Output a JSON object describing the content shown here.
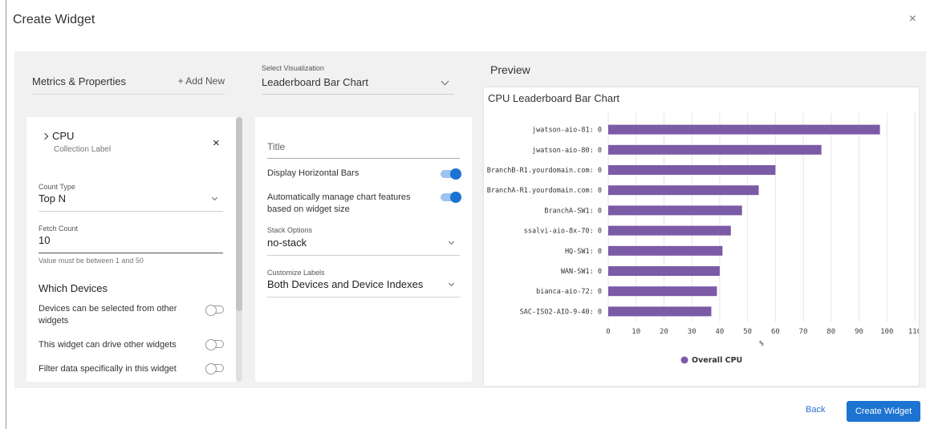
{
  "dialog": {
    "title": "Create Widget",
    "close": "×"
  },
  "metrics": {
    "title": "Metrics & Properties",
    "add_new": "+ Add New",
    "item": {
      "name": "CPU",
      "collection_label": "Collection Label",
      "remove": "×"
    },
    "count_type": {
      "label": "Count Type",
      "value": "Top N"
    },
    "fetch_count": {
      "label": "Fetch Count",
      "value": "10",
      "hint": "Value must be between 1 and 50"
    },
    "which_devices": {
      "title": "Which Devices",
      "toggles": [
        {
          "label": "Devices can be selected from other widgets",
          "on": false
        },
        {
          "label": "This widget can drive other widgets",
          "on": false
        },
        {
          "label": "Filter data specifically in this widget",
          "on": false
        }
      ]
    }
  },
  "visualization": {
    "label": "Select Visualization",
    "value": "Leaderboard Bar Chart",
    "title_placeholder": "Title",
    "horizontal_bars": {
      "label": "Display Horizontal Bars",
      "on": true
    },
    "auto_manage": {
      "label": "Automatically manage chart features based on widget size",
      "on": true
    },
    "stack_options": {
      "label": "Stack Options",
      "value": "no-stack"
    },
    "customize_labels": {
      "label": "Customize Labels",
      "value": "Both Devices and Device Indexes"
    }
  },
  "preview": {
    "label": "Preview"
  },
  "chart_data": {
    "type": "bar",
    "orientation": "horizontal",
    "title": "CPU Leaderboard Bar Chart",
    "categories": [
      "jwatson-aio-81: 0",
      "jwatson-aio-80: 0",
      "BranchB-R1.yourdomain.com: 0",
      "BranchA-R1.yourdomain.com: 0",
      "BranchA-SW1: 0",
      "ssalvi-aio-8x-70: 0",
      "HQ-SW1: 0",
      "WAN-SW1: 0",
      "bianca-aio-72: 0",
      "SAC-ISO2-AIO-9-40: 0"
    ],
    "series": [
      {
        "name": "Overall CPU",
        "values": [
          97.5,
          76.5,
          60,
          54,
          48,
          44,
          41,
          40,
          39,
          37
        ],
        "color": "#7b5aa6"
      }
    ],
    "xlabel": "%",
    "xlim": [
      0,
      110
    ],
    "xticks": [
      0,
      10,
      20,
      30,
      40,
      50,
      60,
      70,
      80,
      90,
      100,
      110
    ],
    "grid": true,
    "legend": "bottom"
  },
  "footer": {
    "back": "Back",
    "create": "Create Widget"
  }
}
